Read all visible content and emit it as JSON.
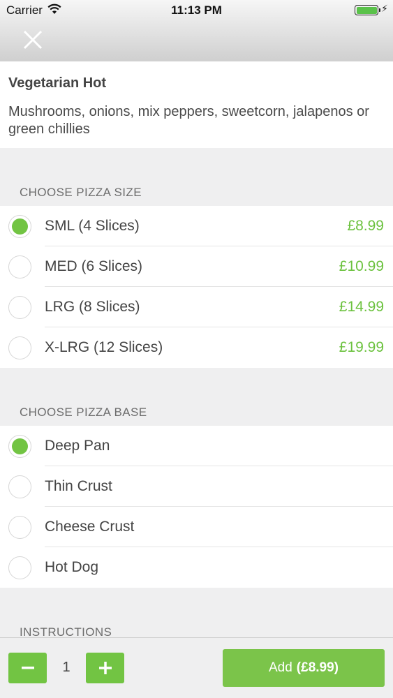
{
  "status_bar": {
    "carrier": "Carrier",
    "time": "11:13 PM"
  },
  "item": {
    "title": "Vegetarian Hot",
    "description": "Mushrooms, onions, mix peppers, sweetcorn, jalapenos or green chillies"
  },
  "size_section": {
    "header": "CHOOSE PIZZA SIZE",
    "options": [
      {
        "label": "SML (4 Slices)",
        "price": "£8.99",
        "selected": true
      },
      {
        "label": "MED (6 Slices)",
        "price": "£10.99",
        "selected": false
      },
      {
        "label": "LRG (8 Slices)",
        "price": "£14.99",
        "selected": false
      },
      {
        "label": "X-LRG (12 Slices)",
        "price": "£19.99",
        "selected": false
      }
    ]
  },
  "base_section": {
    "header": "CHOOSE PIZZA BASE",
    "options": [
      {
        "label": "Deep Pan",
        "selected": true
      },
      {
        "label": "Thin Crust",
        "selected": false
      },
      {
        "label": "Cheese Crust",
        "selected": false
      },
      {
        "label": "Hot Dog",
        "selected": false
      }
    ]
  },
  "instructions_section": {
    "header": "INSTRUCTIONS"
  },
  "footer": {
    "quantity": "1",
    "add_label": "Add",
    "add_price": "(£8.99)"
  },
  "colors": {
    "accent_green": "#72c443",
    "price_green": "#6cc23f",
    "background": "#efeff0"
  }
}
